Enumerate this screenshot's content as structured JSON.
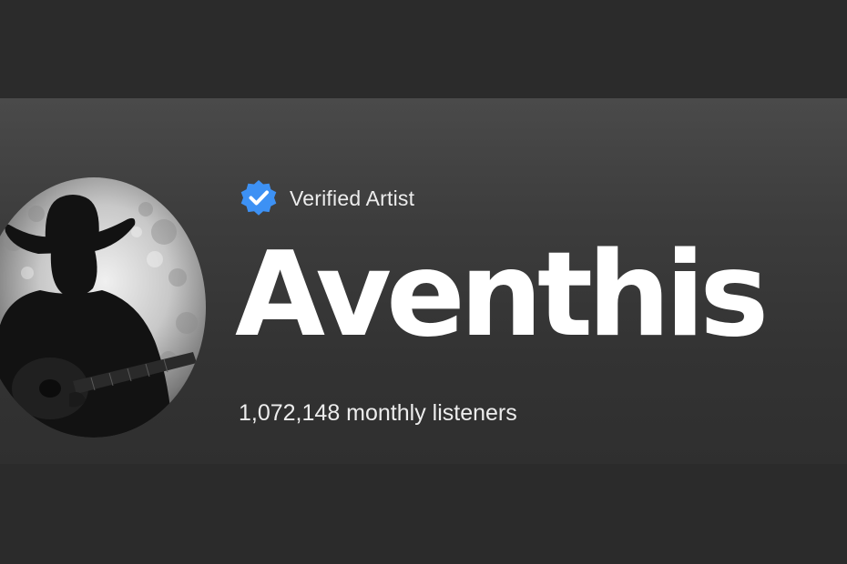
{
  "artist": {
    "name": "Aventhis",
    "verified_label": "Verified Artist",
    "monthly_listeners": "1,072,148 monthly listeners",
    "verified_badge_icon": "verified-check-badge-icon",
    "avatar_subject": "cowboy-silhouette-with-guitar"
  },
  "colors": {
    "page_background": "#2b2b2b",
    "header_gradient_top": "#4a4a4a",
    "header_gradient_bottom": "#2f2f2f",
    "verified_badge": "#3d91f4",
    "text_primary": "#ffffff",
    "text_secondary": "#ededed"
  }
}
